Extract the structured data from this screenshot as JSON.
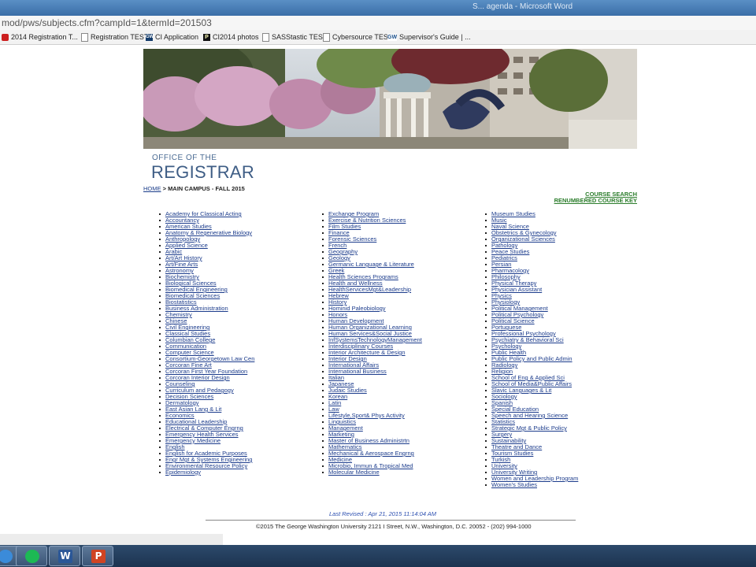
{
  "window": {
    "title": "S... agenda - Microsoft Word"
  },
  "address_bar": {
    "url": "mod/pws/subjects.cfm?campId=1&termId=201503"
  },
  "bookmarks": [
    {
      "label": "2014 Registration T...",
      "icon": "youtube-icon"
    },
    {
      "label": "Registration TEST",
      "icon": "page-icon"
    },
    {
      "label": "CI Application",
      "icon": "gw-icon"
    },
    {
      "label": "CI2014 photos",
      "icon": "p-icon"
    },
    {
      "label": "SASStastic TEST",
      "icon": "page-icon"
    },
    {
      "label": "Cybersource TEST",
      "icon": "page-icon"
    },
    {
      "label": "Supervisor's Guide | ...",
      "icon": "gw-icon"
    }
  ],
  "header": {
    "office_of": "OFFICE OF THE",
    "registrar": "REGISTRAR"
  },
  "breadcrumb": {
    "home": "HOME",
    "separator": " > ",
    "current": "MAIN CAMPUS - FALL 2015"
  },
  "links": {
    "course_search": "COURSE SEARCH",
    "renumbered": "RENUMBERED COURSE KEY"
  },
  "subjects": {
    "col1": [
      "Academy for Classical Acting",
      "Accountancy",
      "American Studies",
      "Anatomy & Regenerative Biology",
      "Anthropology",
      "Applied Science",
      "Arabic",
      "Art/Art History",
      "Art/Fine Arts",
      "Astronomy",
      "Biochemistry",
      "Biological Sciences",
      "Biomedical Engineering",
      "Biomedical Sciences",
      "Biostatistics",
      "Business Administration",
      "Chemistry",
      "Chinese",
      "Civil Engineering",
      "Classical Studies",
      "Columbian College",
      "Communication",
      "Computer Science",
      "Consortium-Georgetown Law Cen",
      "Corcoran Fine Art",
      "Corcoran First Year Foundation",
      "Corcoran Interior Design",
      "Counseling",
      "Curriculum and Pedagogy",
      "Decision Sciences",
      "Dermatology",
      "East Asian Lang & Lit",
      "Economics",
      "Educational Leadership",
      "Electrical & Computer Engrng",
      "Emergency Health Services",
      "Emergency Medicine",
      "English",
      "English for Academic Purposes",
      "Engr Mgt & Systems Engineering",
      "Environmental Resource Policy",
      "Epidemiology"
    ],
    "col2": [
      "Exchange Program",
      "Exercise & Nutrition Sciences",
      "Film Studies",
      "Finance",
      "Forensic Sciences",
      "French",
      "Geography",
      "Geology",
      "Germanic Language & Literature",
      "Greek",
      "Health Sciences Programs",
      "Health and Wellness",
      "HealthServicesMgt&Leadership",
      "Hebrew",
      "History",
      "Hominid Paleobiology",
      "Honors",
      "Human Development",
      "Human Organizational Learning",
      "Human Services&Social Justice",
      "InfSystemsTechnologyManagement",
      "Interdisciplinary Courses",
      "Interior Architecture & Design",
      "Interior Design",
      "International Affairs",
      "International Business",
      "Italian",
      "Japanese",
      "Judaic Studies",
      "Korean",
      "Latin",
      "Law",
      "Lifestyle,Sport& Phys Activity",
      "Linguistics",
      "Management",
      "Marketing",
      "Master of Business Administrtn",
      "Mathematics",
      "Mechanical & Aerospace Engrng",
      "Medicine",
      "Microbio, Immun & Tropical Med",
      "Molecular Medicine"
    ],
    "col3": [
      "Museum Studies",
      "Music",
      "Naval Science",
      "Obstetrics & Gynecology",
      "Organizational Sciences",
      "Pathology",
      "Peace Studies",
      "Pediatrics",
      "Persian",
      "Pharmacology",
      "Philosophy",
      "Physical Therapy",
      "Physician Assistant",
      "Physics",
      "Physiology",
      "Political Management",
      "Political Psychology",
      "Political Science",
      "Portuguese",
      "Professional Psychology",
      "Psychiatry & Behavioral Sci",
      "Psychology",
      "Public Health",
      "Public Policy and Public Admin",
      "Radiology",
      "Religion",
      "School of Eng & Applied Sci",
      "School of Media&Public Affairs",
      "Slavic Languages & Lit",
      "Sociology",
      "Spanish",
      "Special Education",
      "Speech and Hearing Science",
      "Statistics",
      "Strategic Mgt & Public Policy",
      "Surgery",
      "Sustainability",
      "Theatre and Dance",
      "Tourism Studies",
      "Turkish",
      "University",
      "University Writing",
      "Women and Leadership Program",
      "Women's Studies"
    ]
  },
  "footer": {
    "last_revised": "Last Revised : Apr 21, 2015 11:14:04 AM",
    "copyright": "©2015 The George Washington University 2121 I Street, N.W., Washington, D.C. 20052 - (202) 994-1000"
  },
  "taskbar": [
    {
      "app": "ie",
      "icon": "internet-explorer-icon"
    },
    {
      "app": "spotify",
      "icon": "spotify-icon"
    },
    {
      "app": "word",
      "icon": "word-icon",
      "glyph": "W"
    },
    {
      "app": "powerpoint",
      "icon": "powerpoint-icon",
      "glyph": "P"
    }
  ]
}
